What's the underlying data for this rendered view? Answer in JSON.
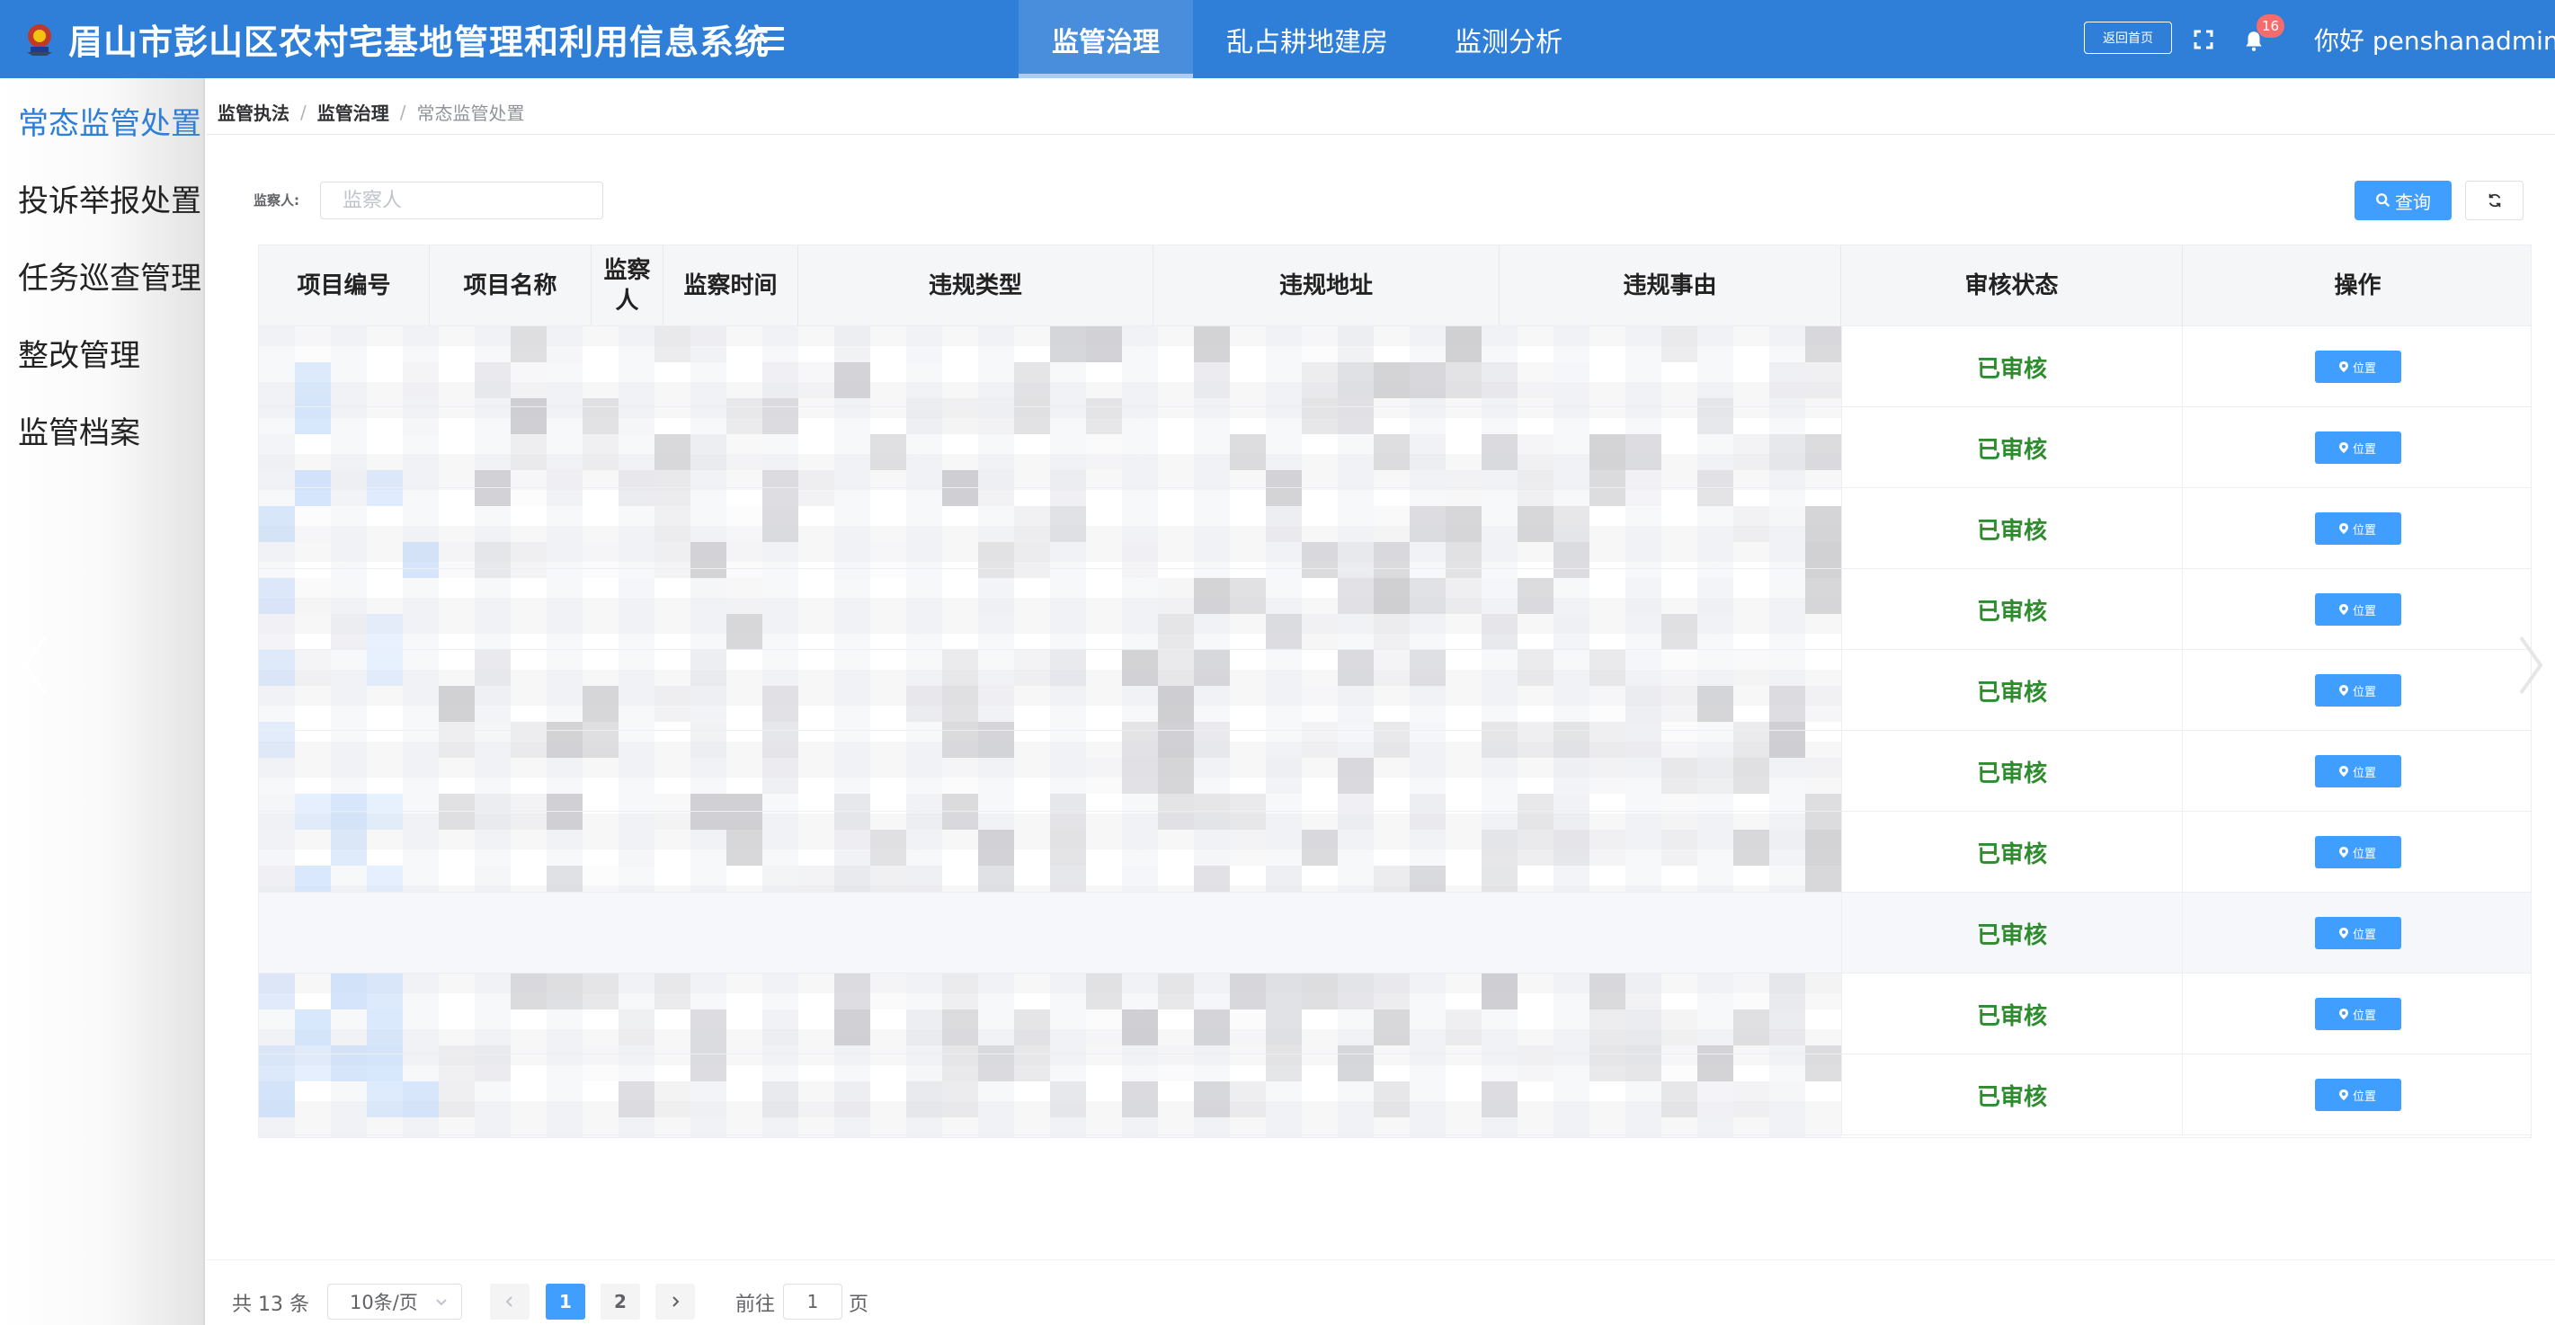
{
  "header": {
    "title": "眉山市彭山区农村宅基地管理和利用信息系统",
    "tabs": [
      {
        "label": "监管治理",
        "active": true
      },
      {
        "label": "乱占耕地建房",
        "active": false
      },
      {
        "label": "监测分析",
        "active": false
      }
    ],
    "back_home": "返回首页",
    "notification_count": "16",
    "greeting": "你好 penshanadmin"
  },
  "sidebar": {
    "items": [
      {
        "label": "常态监管处置",
        "active": true
      },
      {
        "label": "投诉举报处置",
        "active": false
      },
      {
        "label": "任务巡查管理",
        "active": false
      },
      {
        "label": "整改管理",
        "active": false
      },
      {
        "label": "监管档案",
        "active": false
      }
    ]
  },
  "breadcrumb": [
    "监管执法",
    "监管治理",
    "常态监管处置"
  ],
  "filter": {
    "label": "监察人:",
    "placeholder": "监察人",
    "value": "",
    "query_label": "查询"
  },
  "table": {
    "columns": [
      "项目编号",
      "项目名称",
      "监察人",
      "监察时间",
      "违规类型",
      "违规地址",
      "违规事由",
      "审核状态",
      "操作"
    ],
    "rows": [
      {
        "status": "已审核",
        "action": "位置"
      },
      {
        "status": "已审核",
        "action": "位置"
      },
      {
        "status": "已审核",
        "action": "位置"
      },
      {
        "status": "已审核",
        "action": "位置"
      },
      {
        "status": "已审核",
        "action": "位置"
      },
      {
        "status": "已审核",
        "action": "位置"
      },
      {
        "status": "已审核",
        "action": "位置"
      },
      {
        "status": "已审核",
        "action": "位置"
      },
      {
        "status": "已审核",
        "action": "位置"
      },
      {
        "status": "已审核",
        "action": "位置"
      }
    ]
  },
  "pagination": {
    "total": "共 13 条",
    "page_size": "10条/页",
    "pages": [
      "1",
      "2"
    ],
    "current_page": "1",
    "goto_label": "前往",
    "goto_value": "1",
    "goto_suffix": "页"
  },
  "colors": {
    "header_bg": "#2f7fd8",
    "primary": "#409eff",
    "status_ok": "#2e8b2e",
    "badge": "#f56c6c"
  }
}
